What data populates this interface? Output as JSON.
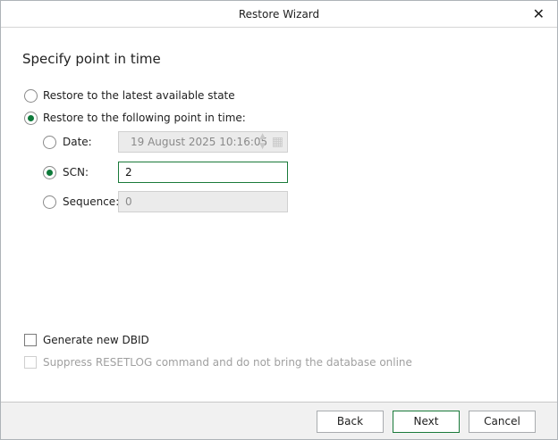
{
  "window": {
    "title": "Restore Wizard"
  },
  "heading": "Specify point in time",
  "options": {
    "latest": {
      "label": "Restore to the latest available state",
      "selected": false
    },
    "point": {
      "label": "Restore to the following point in time:",
      "selected": true
    }
  },
  "point": {
    "date": {
      "label": "Date:",
      "value": "19 August 2025 10:16:05",
      "selected": false
    },
    "scn": {
      "label": "SCN:",
      "value": "2",
      "selected": true
    },
    "sequence": {
      "label": "Sequence:",
      "value": "0",
      "selected": false
    }
  },
  "checkboxes": {
    "dbid": {
      "label": "Generate new DBID",
      "checked": false
    },
    "suppress": {
      "label": "Suppress RESETLOG command and do not bring the database online",
      "checked": false,
      "disabled": true
    }
  },
  "footer": {
    "back": "Back",
    "next": "Next",
    "cancel": "Cancel"
  },
  "colors": {
    "accent": "#0e7a3a"
  }
}
